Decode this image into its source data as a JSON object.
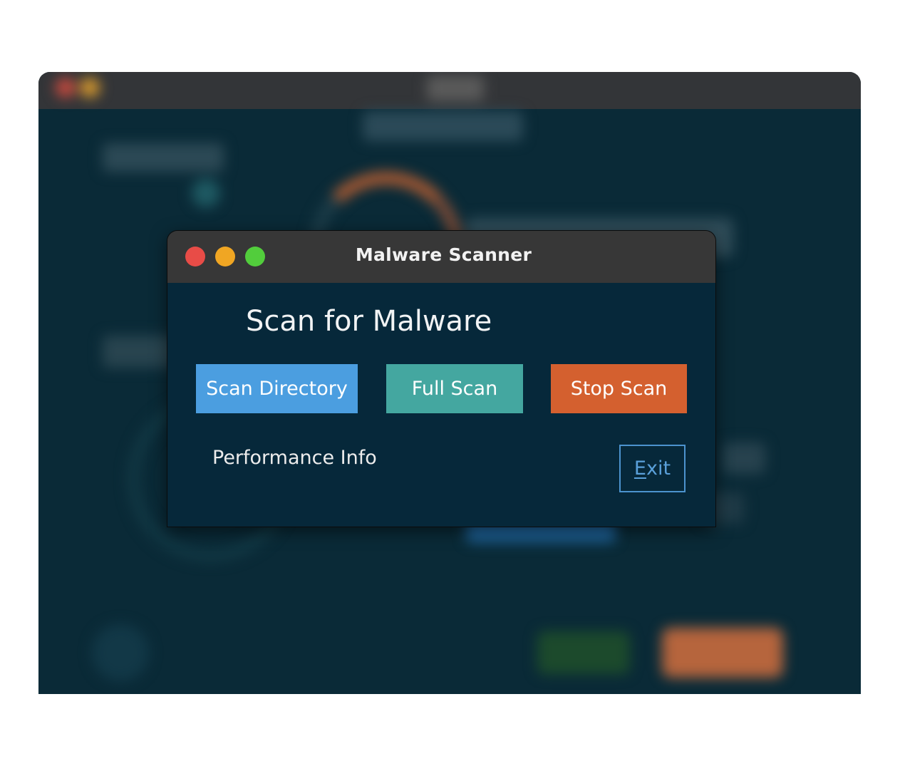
{
  "window": {
    "title": "Malware Scanner"
  },
  "main": {
    "heading": "Scan for Malware",
    "buttons": {
      "scan_directory": "Scan Directory",
      "full_scan": "Full Scan",
      "stop_scan": "Stop Scan"
    },
    "performance_label": "Performance Info",
    "exit": {
      "mnemonic": "E",
      "rest": "xit"
    }
  },
  "colors": {
    "dialog_background": "#06283a",
    "titlebar": "#373737",
    "scan_directory_button": "#4b9ee0",
    "full_scan_button": "#44a7a0",
    "stop_scan_button": "#d4602f",
    "exit_border": "#4c93ce",
    "traffic_close": "#e84c47",
    "traffic_minimize": "#f0a623",
    "traffic_zoom": "#52cd3c"
  },
  "icons": {
    "close": "close-dot-icon",
    "minimize": "minimize-dot-icon",
    "zoom": "zoom-dot-icon"
  }
}
